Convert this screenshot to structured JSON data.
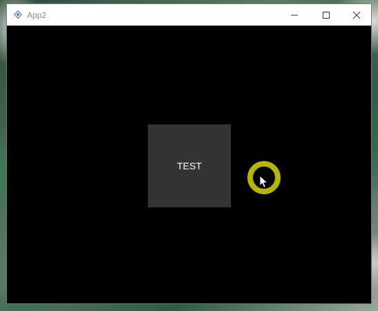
{
  "window": {
    "title": "App2",
    "buttons": {
      "minimize": "minimize-icon",
      "maximize": "maximize-icon",
      "close": "close-icon"
    }
  },
  "content": {
    "test_button_label": "TEST"
  },
  "colors": {
    "window_background": "#000000",
    "button_background": "#333333",
    "button_text": "#ffffff",
    "click_indicator": "#b5b500"
  }
}
